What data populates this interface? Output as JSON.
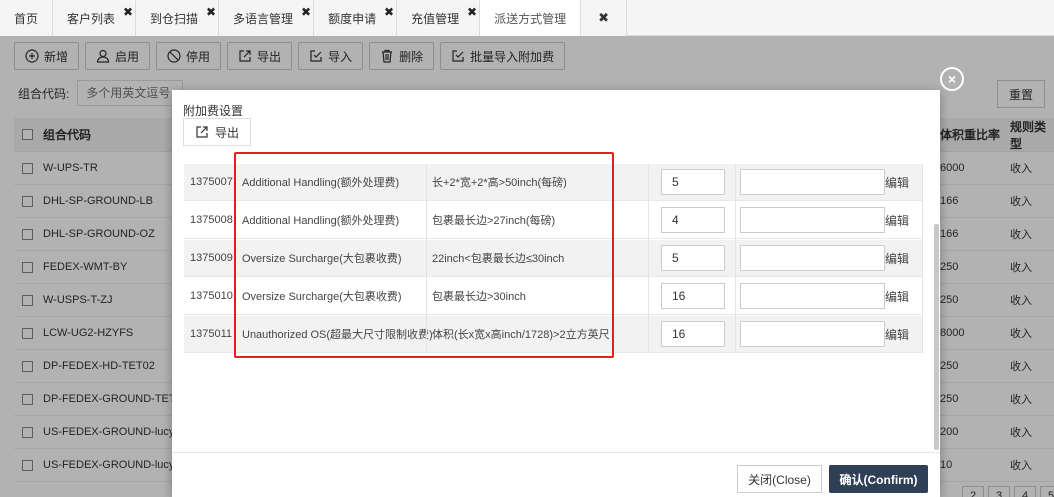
{
  "tabs": [
    {
      "label": "首页",
      "closable": false
    },
    {
      "label": "客户列表",
      "closable": true
    },
    {
      "label": "到仓扫描",
      "closable": true
    },
    {
      "label": "多语言管理",
      "closable": true
    },
    {
      "label": "额度申请",
      "closable": true
    },
    {
      "label": "充值管理",
      "closable": true
    },
    {
      "label": "派送方式管理",
      "closable": false,
      "active": true
    }
  ],
  "tab_close_all": "✖",
  "toolbar": {
    "add": "新增",
    "enable": "启用",
    "disable": "停用",
    "export": "导出",
    "import": "导入",
    "delete": "删除",
    "batch_import": "批量导入附加费"
  },
  "filter": {
    "label": "组合代码:",
    "placeholder": "多个用英文逗号"
  },
  "reset": "重置",
  "grid": {
    "col_code": "组合代码",
    "col_ratio": "体积重比率",
    "col_rule_type": "规则类型",
    "rows": [
      {
        "code": "W-UPS-TR",
        "ratio": "6000",
        "type": "收入"
      },
      {
        "code": "DHL-SP-GROUND-LB",
        "ratio": "166",
        "type": "收入"
      },
      {
        "code": "DHL-SP-GROUND-OZ",
        "ratio": "166",
        "type": "收入"
      },
      {
        "code": "FEDEX-WMT-BY",
        "ratio": "250",
        "type": "收入"
      },
      {
        "code": "W-USPS-T-ZJ",
        "ratio": "250",
        "type": "收入"
      },
      {
        "code": "LCW-UG2-HZYFS",
        "ratio": "8000",
        "type": "收入"
      },
      {
        "code": "DP-FEDEX-HD-TET02",
        "ratio": "250",
        "type": "收入"
      },
      {
        "code": "DP-FEDEX-GROUND-TET02",
        "ratio": "250",
        "type": "收入"
      },
      {
        "code": "US-FEDEX-GROUND-lucy01",
        "ratio": "200",
        "type": "收入"
      },
      {
        "code": "US-FEDEX-GROUND-lucy",
        "ratio": "10",
        "type": "收入"
      }
    ]
  },
  "pager": [
    "2",
    "3",
    "4",
    "5"
  ],
  "modal": {
    "title": "附加费设置",
    "export": "导出",
    "close_x": "×",
    "rows": [
      {
        "id": "1375007",
        "name": "Additional Handling(额外处理费)",
        "rule": "长+2*宽+2*高>50inch(每磅)",
        "value": "5",
        "edit": "编辑"
      },
      {
        "id": "1375008",
        "name": "Additional Handling(额外处理费)",
        "rule": "包裹最长边>27inch(每磅)",
        "value": "4",
        "edit": "编辑"
      },
      {
        "id": "1375009",
        "name": "Oversize Surcharge(大包裹收费)",
        "rule": "22inch<包裹最长边≤30inch",
        "value": "5",
        "edit": "编辑"
      },
      {
        "id": "1375010",
        "name": "Oversize Surcharge(大包裹收费)",
        "rule": "包裹最长边>30inch",
        "value": "16",
        "edit": "编辑"
      },
      {
        "id": "1375011",
        "name": "Unauthorized OS(超最大尺寸限制收费)",
        "rule": "体积(长x宽x高inch/1728)>2立方英尺",
        "value": "16",
        "edit": "编辑"
      }
    ],
    "close_button": "关闭(Close)",
    "confirm_button": "确认(Confirm)"
  },
  "colors": {
    "highlight_border": "#e02020",
    "confirm_bg": "#2f4056"
  }
}
